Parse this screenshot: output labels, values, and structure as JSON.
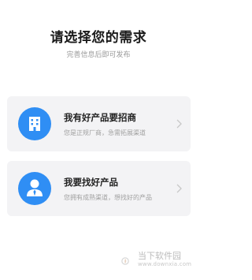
{
  "header": {
    "title": "请选择您的需求",
    "subtitle": "完善信息后即可发布"
  },
  "options": [
    {
      "icon": "building-icon",
      "title": "我有好产品要招商",
      "desc": "您是正规厂商，急需拓展渠道"
    },
    {
      "icon": "user-tie-icon",
      "title": "我要找好产品",
      "desc": "您拥有成熟渠道，想找好的产品"
    }
  ],
  "watermark": {
    "logo": "dangxia-logo-icon",
    "text": "当下软件园",
    "url": "www.downxia.com"
  },
  "colors": {
    "accent": "#2f8ef4",
    "card_bg": "#f3f3f5",
    "title": "#1a1a1a",
    "muted": "#999999"
  }
}
